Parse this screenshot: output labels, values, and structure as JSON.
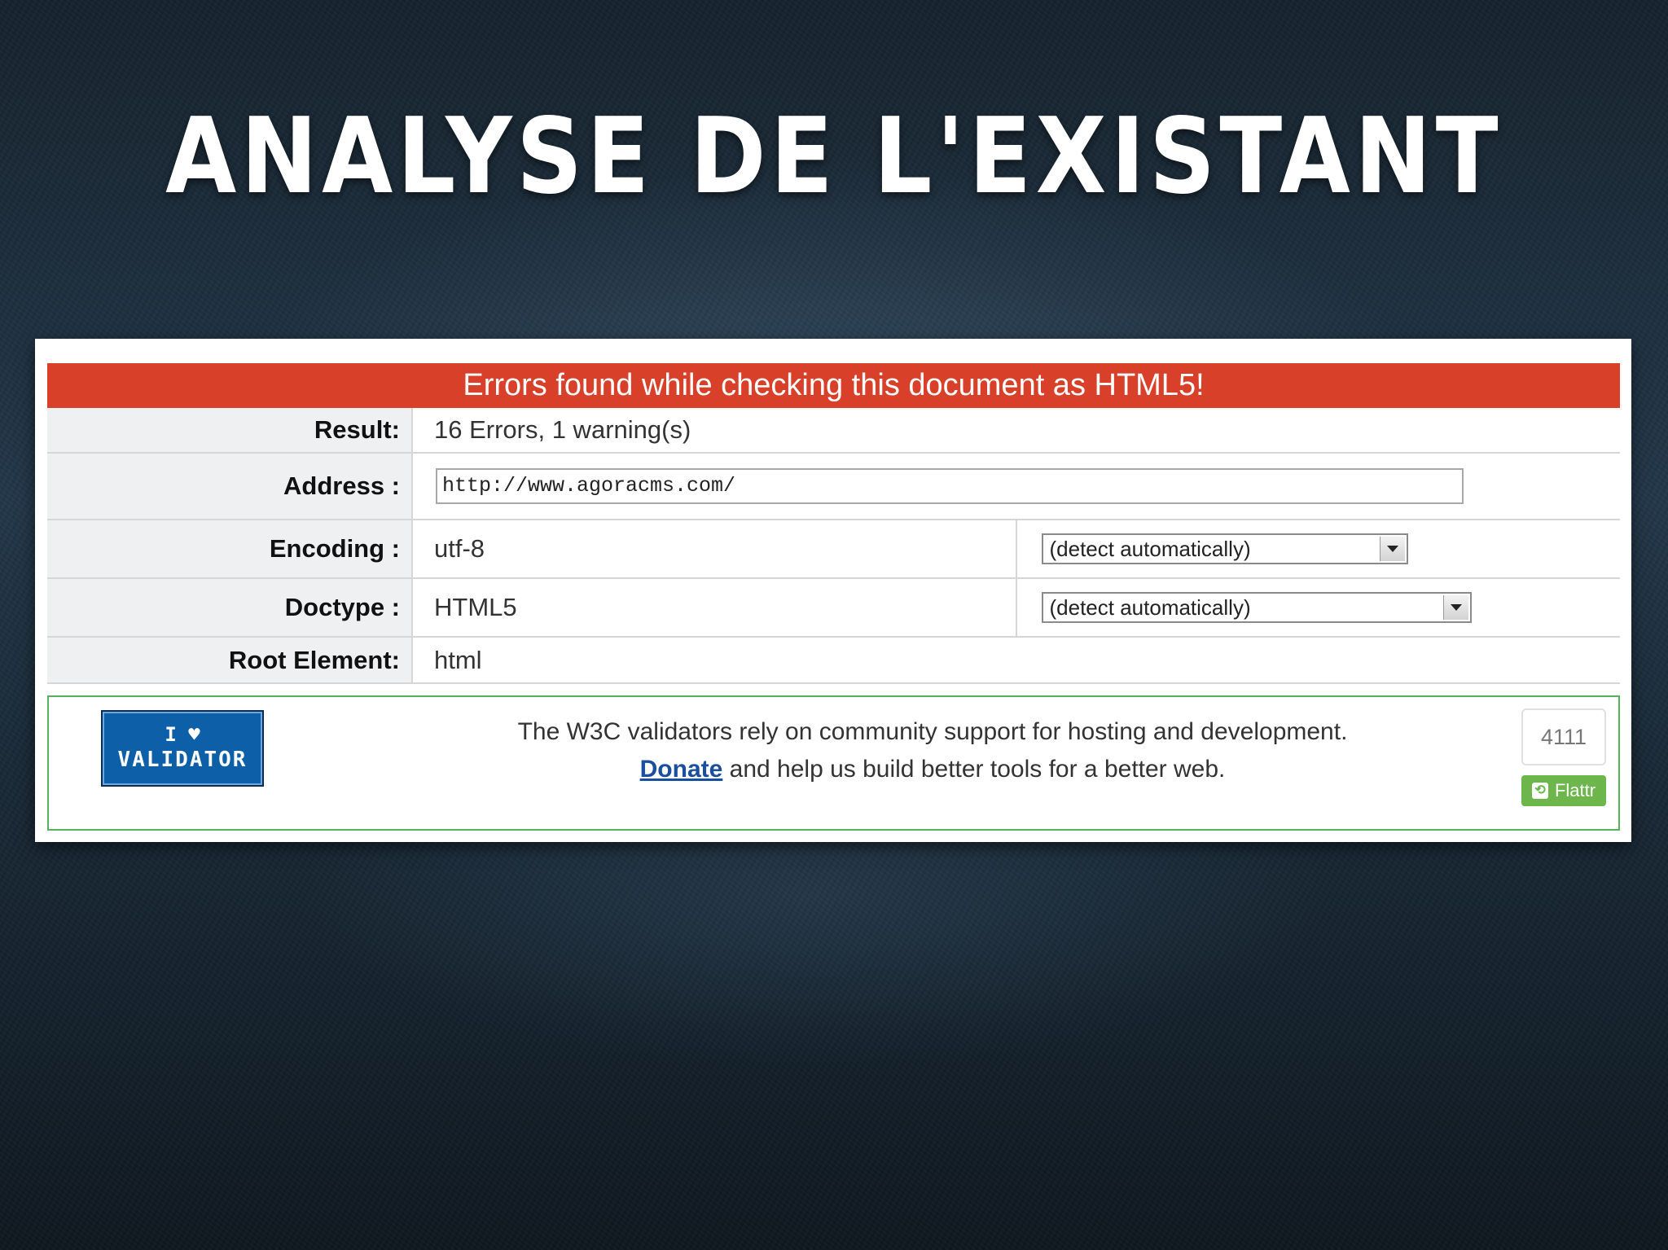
{
  "slide": {
    "title": "ANALYSE DE L'EXISTANT"
  },
  "validator": {
    "banner": "Errors found while checking this document as HTML5!",
    "rows": {
      "result": {
        "label": "Result:",
        "value": "16 Errors, 1 warning(s)"
      },
      "address": {
        "label": "Address :",
        "value": "http://www.agoracms.com/"
      },
      "encoding": {
        "label": "Encoding :",
        "value": "utf-8",
        "select": "(detect automatically)"
      },
      "doctype": {
        "label": "Doctype :",
        "value": "HTML5",
        "select": "(detect automatically)"
      },
      "root": {
        "label": "Root Element:",
        "value": "html"
      }
    },
    "donate": {
      "badge_top": "I ♥",
      "badge_bottom": "VALIDATOR",
      "line1": "The W3C validators rely on community support for hosting and development.",
      "link": "Donate",
      "line2_rest": " and help us build better tools for a better web.",
      "flattr_count": "4111",
      "flattr_label": "Flattr"
    },
    "colors": {
      "error": "#d9402a",
      "box_border": "#57b25b",
      "flattr": "#6cb64b",
      "badge": "#0d5fa8"
    }
  }
}
